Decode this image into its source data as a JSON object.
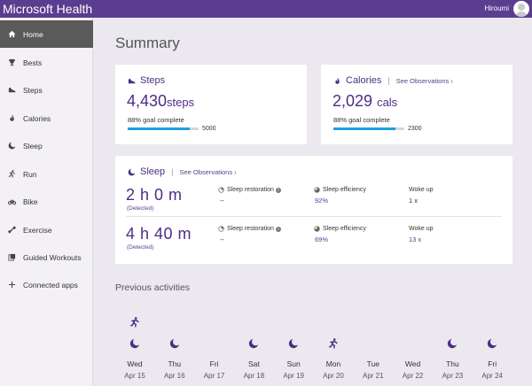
{
  "app": {
    "title": "Microsoft Health",
    "user": "Hiroumi"
  },
  "colors": {
    "accent": "#5a3d8f",
    "brand_text": "#4b2d85",
    "progress": "#1ba1e2",
    "active_nav": "#5a5a5a"
  },
  "sidebar": {
    "items": [
      {
        "label": "Home",
        "icon": "home-icon",
        "active": true
      },
      {
        "label": "Bests",
        "icon": "trophy-icon"
      },
      {
        "label": "Steps",
        "icon": "shoe-icon"
      },
      {
        "label": "Calories",
        "icon": "flame-icon"
      },
      {
        "label": "Sleep",
        "icon": "moon-icon"
      },
      {
        "label": "Run",
        "icon": "runner-icon"
      },
      {
        "label": "Bike",
        "icon": "bike-icon"
      },
      {
        "label": "Exercise",
        "icon": "exercise-icon"
      },
      {
        "label": "Guided Workouts",
        "icon": "workout-icon"
      },
      {
        "label": "Connected apps",
        "icon": "plus-icon"
      }
    ]
  },
  "summary": {
    "title": "Summary",
    "steps": {
      "title": "Steps",
      "value": "4,430",
      "unit": "steps",
      "goal_text": "88% goal complete",
      "goal_fraction": 0.88,
      "target": "5000"
    },
    "calories": {
      "title": "Calories",
      "see_observations": "See Observations ›",
      "value": "2,029",
      "unit": "cals",
      "goal_text": "88% goal complete",
      "goal_fraction": 0.88,
      "target": "2300"
    },
    "sleep": {
      "title": "Sleep",
      "see_observations": "See Observations ›",
      "rows": [
        {
          "duration": "2 h 0 m",
          "detected": "(Detected)",
          "restoration_label": "Sleep restoration",
          "restoration_value": "--",
          "efficiency_label": "Sleep efficiency",
          "efficiency_value": "92%",
          "wokeup_label": "Woke up",
          "wokeup_value": "1 x"
        },
        {
          "duration": "4 h 40 m",
          "detected": "(Detected)",
          "restoration_label": "Sleep restoration",
          "restoration_value": "--",
          "efficiency_label": "Sleep efficiency",
          "efficiency_value": "69%",
          "wokeup_label": "Woke up",
          "wokeup_value": "13 x"
        }
      ]
    }
  },
  "previous_activities": {
    "title": "Previous activities",
    "days": [
      {
        "day": "Wed",
        "date": "Apr 15",
        "activities": [
          "run",
          "sleep"
        ]
      },
      {
        "day": "Thu",
        "date": "Apr 16",
        "activities": [
          "sleep"
        ]
      },
      {
        "day": "Fri",
        "date": "Apr 17",
        "activities": []
      },
      {
        "day": "Sat",
        "date": "Apr 18",
        "activities": [
          "sleep"
        ]
      },
      {
        "day": "Sun",
        "date": "Apr 19",
        "activities": [
          "sleep"
        ]
      },
      {
        "day": "Mon",
        "date": "Apr 20",
        "activities": [
          "run"
        ]
      },
      {
        "day": "Tue",
        "date": "Apr 21",
        "activities": []
      },
      {
        "day": "Wed",
        "date": "Apr 22",
        "activities": []
      },
      {
        "day": "Thu",
        "date": "Apr 23",
        "activities": [
          "sleep"
        ]
      },
      {
        "day": "Fri",
        "date": "Apr 24",
        "activities": [
          "sleep"
        ]
      }
    ]
  }
}
